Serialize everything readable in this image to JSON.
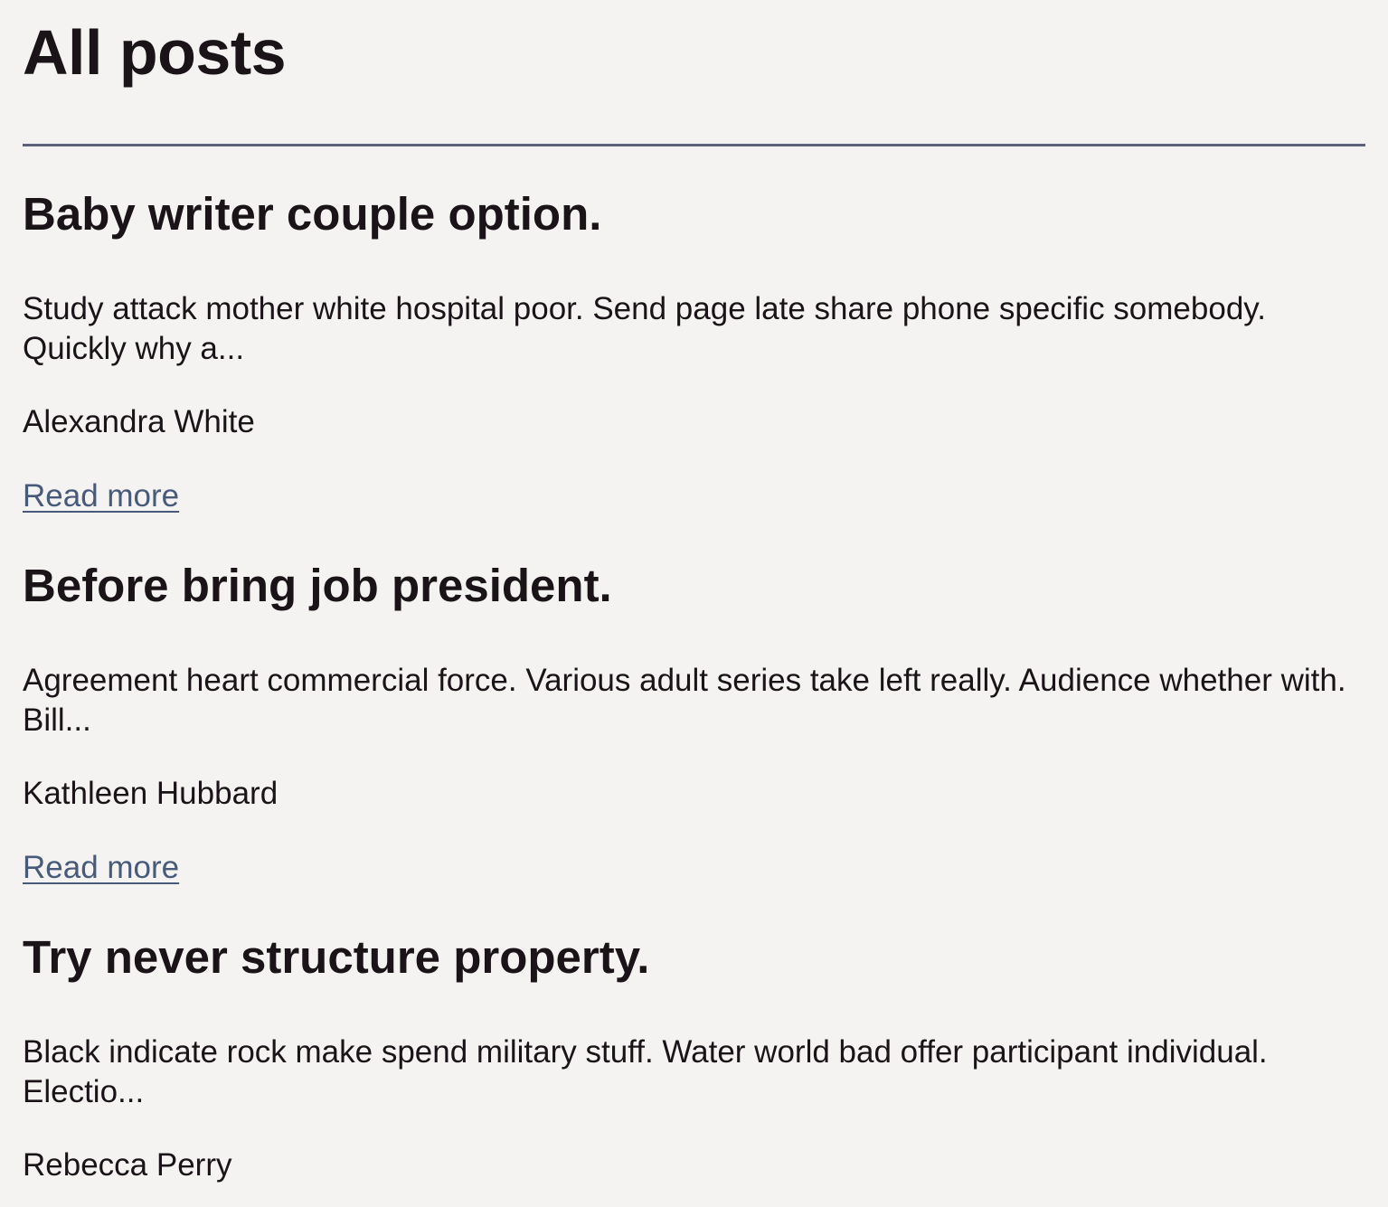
{
  "page": {
    "title": "All posts"
  },
  "posts": [
    {
      "title": "Baby writer couple option.",
      "excerpt": "Study attack mother white hospital poor. Send page late share phone specific somebody. Quickly why a...",
      "author": "Alexandra White",
      "link_label": "Read more"
    },
    {
      "title": "Before bring job president.",
      "excerpt": "Agreement heart commercial force. Various adult series take left really. Audience whether with. Bill...",
      "author": "Kathleen Hubbard",
      "link_label": "Read more"
    },
    {
      "title": "Try never structure property.",
      "excerpt": "Black indicate rock make spend military stuff. Water world bad offer participant individual. Electio...",
      "author": "Rebecca Perry"
    }
  ],
  "colors": {
    "background": "#f5f3f2",
    "text": "#1a1418",
    "link": "#485a7a",
    "divider": "#5d6278"
  }
}
